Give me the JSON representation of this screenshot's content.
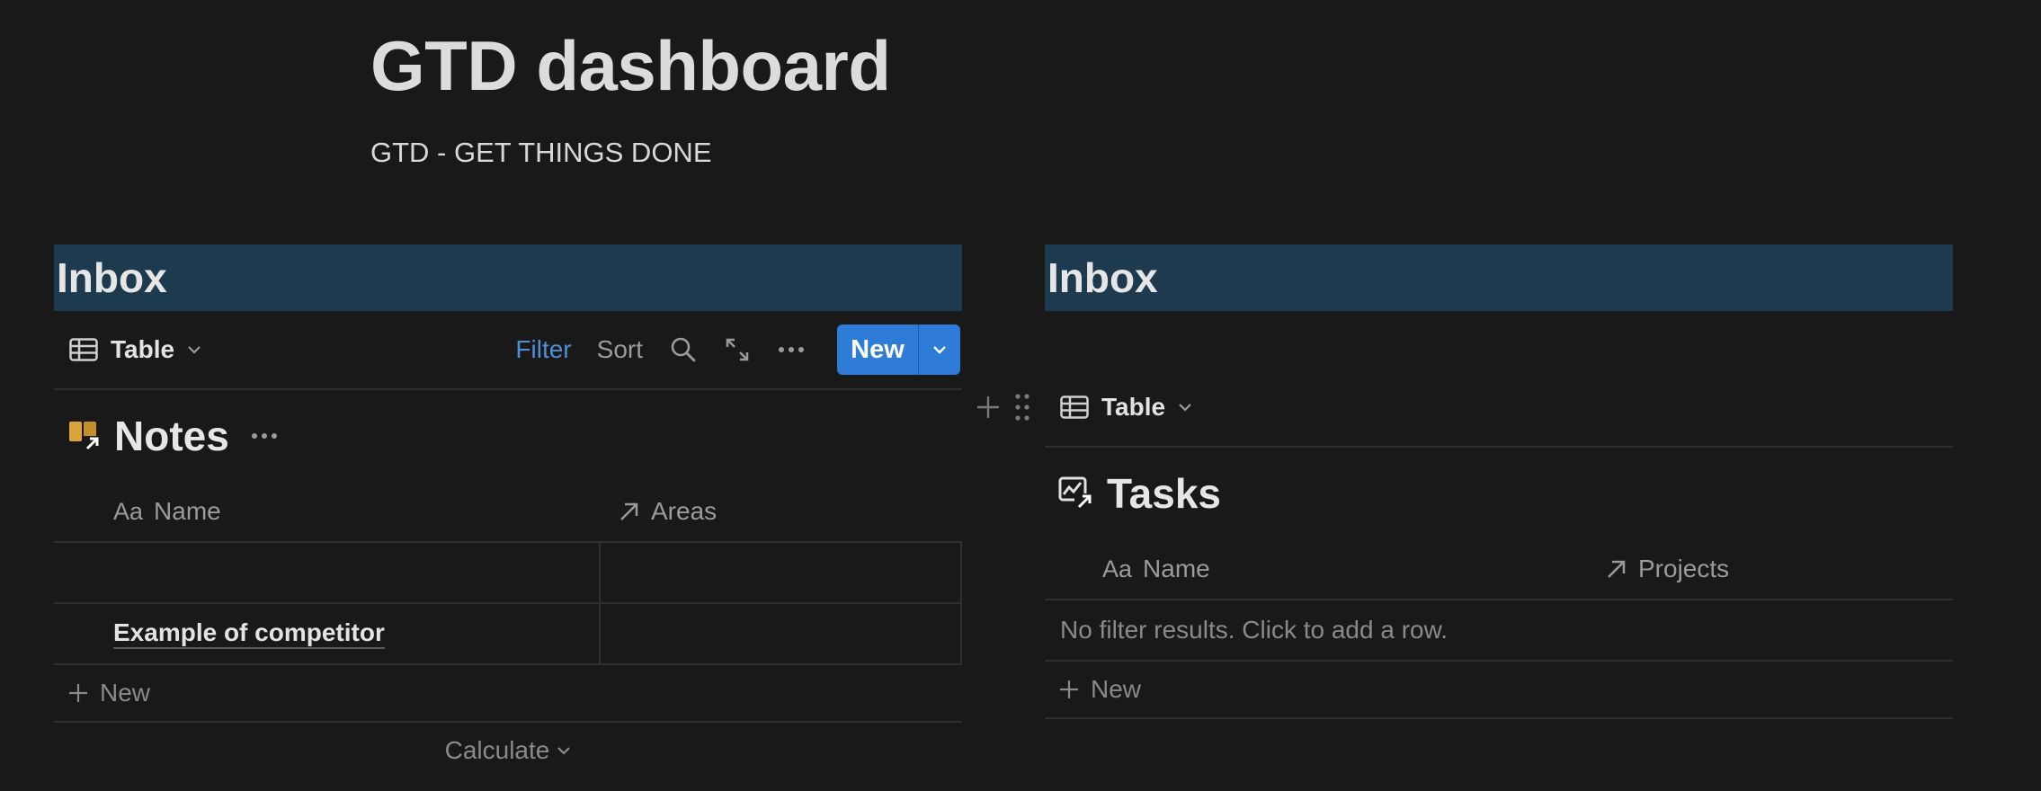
{
  "page": {
    "title": "GTD dashboard",
    "subtitle": "GTD - GET THINGS DONE"
  },
  "left": {
    "heading": "Inbox",
    "view_label": "Table",
    "toolbar": {
      "filter_label": "Filter",
      "sort_label": "Sort",
      "new_label": "New"
    },
    "database_title": "Notes",
    "columns": [
      "Name",
      "Areas"
    ],
    "rows": [
      {
        "name": "",
        "areas": ""
      },
      {
        "name": "Example of competitor",
        "areas": ""
      }
    ],
    "new_row_label": "New",
    "calculate_label": "Calculate"
  },
  "right": {
    "heading": "Inbox",
    "view_label": "Table",
    "database_title": "Tasks",
    "columns": [
      "Name",
      "Projects"
    ],
    "empty_message": "No filter results. Click to add a row.",
    "new_row_label": "New"
  },
  "icons": {
    "table": "table-icon",
    "chevron": "chevron-down-icon",
    "search": "search-icon",
    "expand": "expand-icon",
    "more": "more-icon",
    "title_prop": "text-property-icon",
    "relation": "relation-arrow-icon",
    "plus": "plus-icon",
    "drag": "drag-handle-icon",
    "notes": "notes-book-icon",
    "tasks": "tasks-chart-icon"
  },
  "colors": {
    "background": "#191919",
    "heading_band": "#1e3a4f",
    "accent": "#2e7bd8",
    "filter_active": "#4e8fd6",
    "notes_icon": "#d9a53a"
  }
}
